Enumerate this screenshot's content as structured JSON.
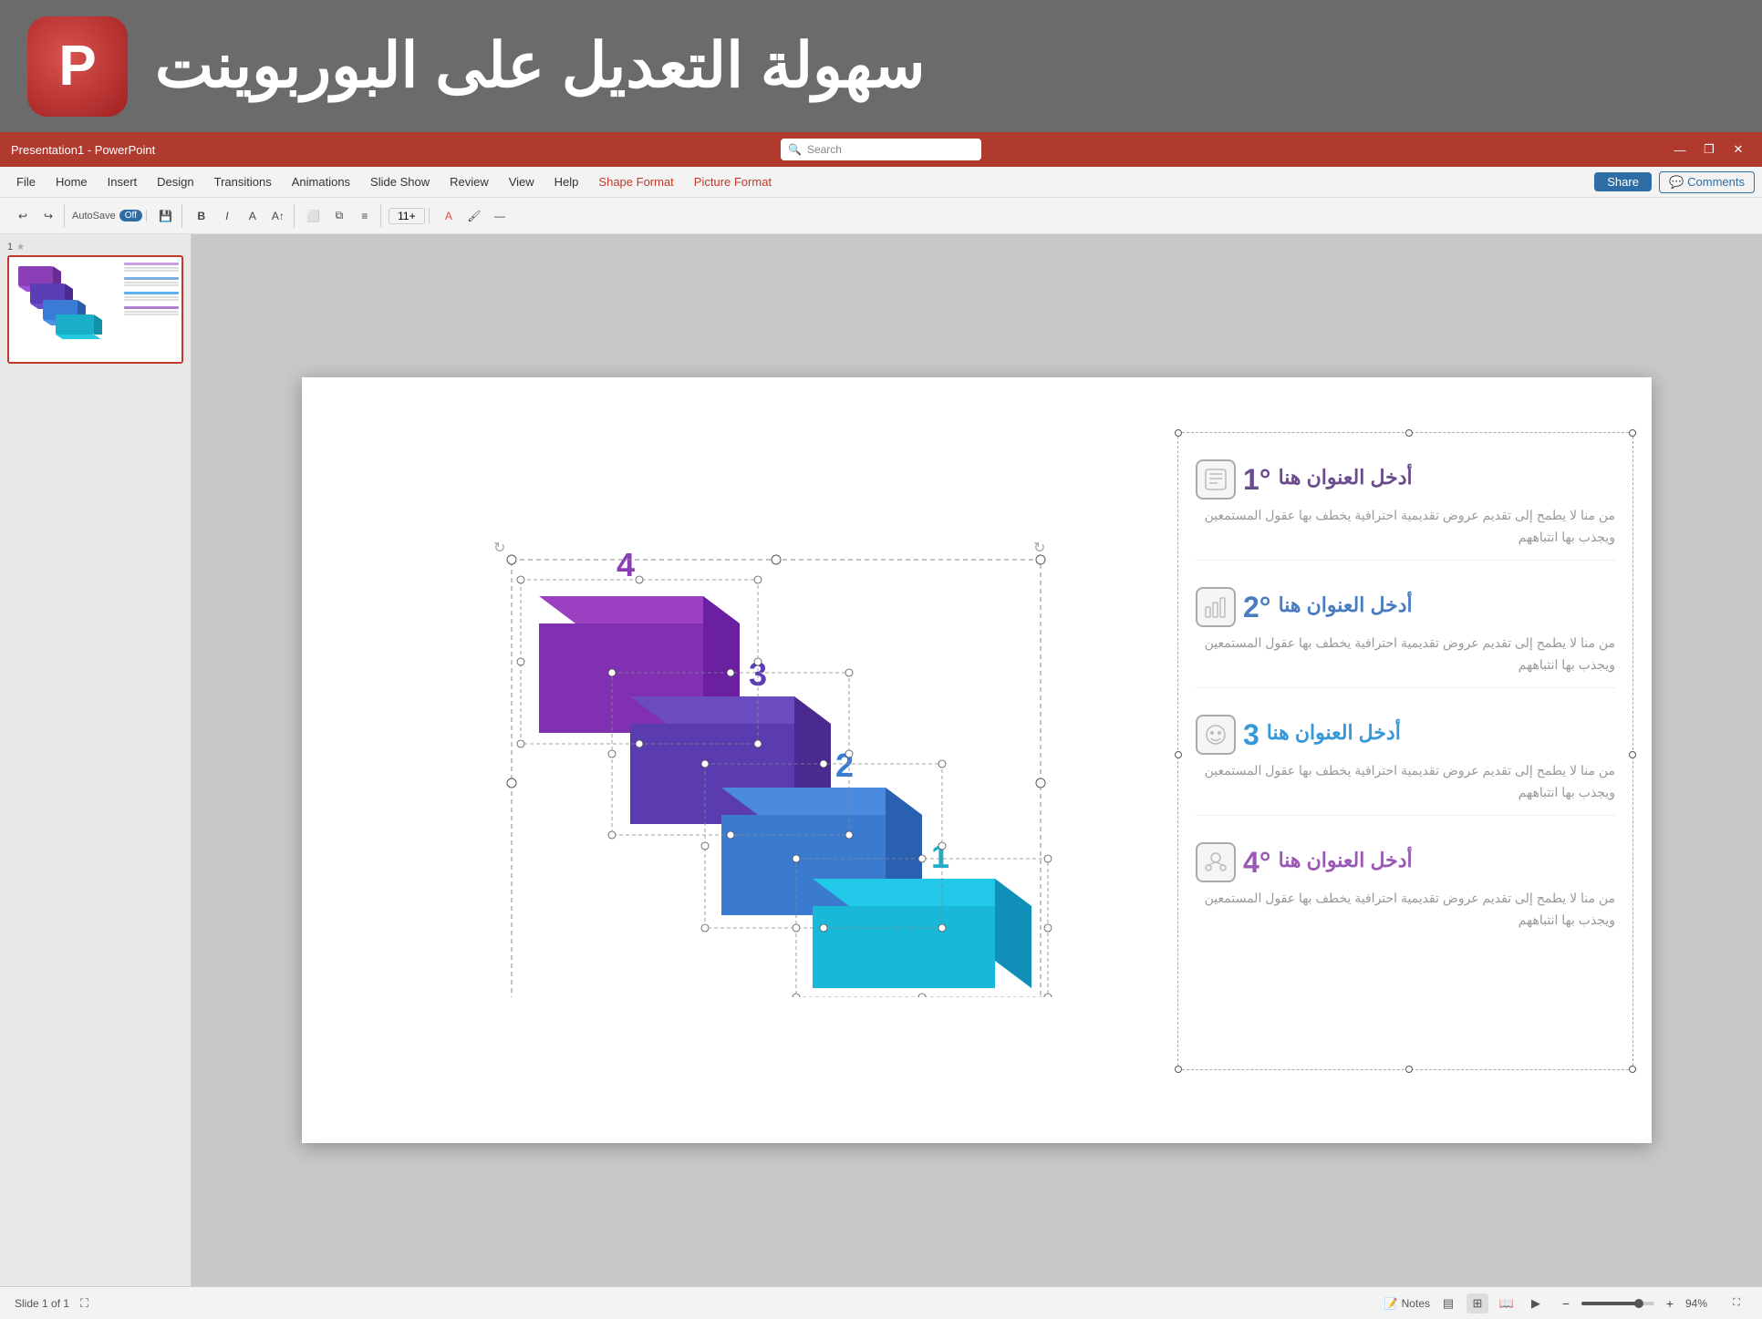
{
  "banner": {
    "logo_letter": "P",
    "title": "سهولة التعديل على البوربوينت"
  },
  "titlebar": {
    "app_name": "Presentation1  -  PowerPoint",
    "search_placeholder": "Search",
    "minimize": "—",
    "restore": "❐",
    "close": "✕"
  },
  "menubar": {
    "items": [
      "File",
      "Home",
      "Insert",
      "Design",
      "Transitions",
      "Animations",
      "Slide Show",
      "Review",
      "View",
      "Help",
      "Shape Format",
      "Picture Format"
    ],
    "share": "Share",
    "comments": "Comments"
  },
  "toolbar": {
    "autosave_label": "AutoSave",
    "autosave_state": "Off",
    "font_size": "11+"
  },
  "slide_panel": {
    "slide_number": "1"
  },
  "infographic": {
    "steps": [
      {
        "number": "4",
        "color": "#8b3db5"
      },
      {
        "number": "3",
        "color": "#5b3db5"
      },
      {
        "number": "2",
        "color": "#3a7bd5"
      },
      {
        "number": "1",
        "color": "#1baec8"
      }
    ],
    "panels": [
      {
        "number": "1",
        "title": "أدخل العنوان هنا",
        "body": "من منا لا يطمح إلى تقديم عروض تقديمية احترافية يخطف بها عقول المستمعين ويجذب بها انتباههم",
        "color_class": "c1"
      },
      {
        "number": "2",
        "title": "أدخل العنوان هنا",
        "body": "من منا لا يطمح إلى تقديم عروض تقديمية احترافية يخطف بها عقول المستمعين ويجذب بها انتباههم",
        "color_class": "c2"
      },
      {
        "number": "3",
        "title": "أدخل العنوان هنا",
        "body": "من منا لا يطمح إلى تقديم عروض تقديمية احترافية يخطف بها عقول المستمعين ويجذب بها انتباههم",
        "color_class": "c3"
      },
      {
        "number": "4",
        "title": "أدخل العنوان هنا",
        "body": "من منا لا يطمح إلى تقديم عروض تقديمية احترافية يخطف بها عقول المستمعين ويجذب بها انتباههم",
        "color_class": "c4"
      }
    ]
  },
  "statusbar": {
    "slide_info": "Slide 1 of 1",
    "notes": "Notes",
    "zoom": "94%"
  }
}
